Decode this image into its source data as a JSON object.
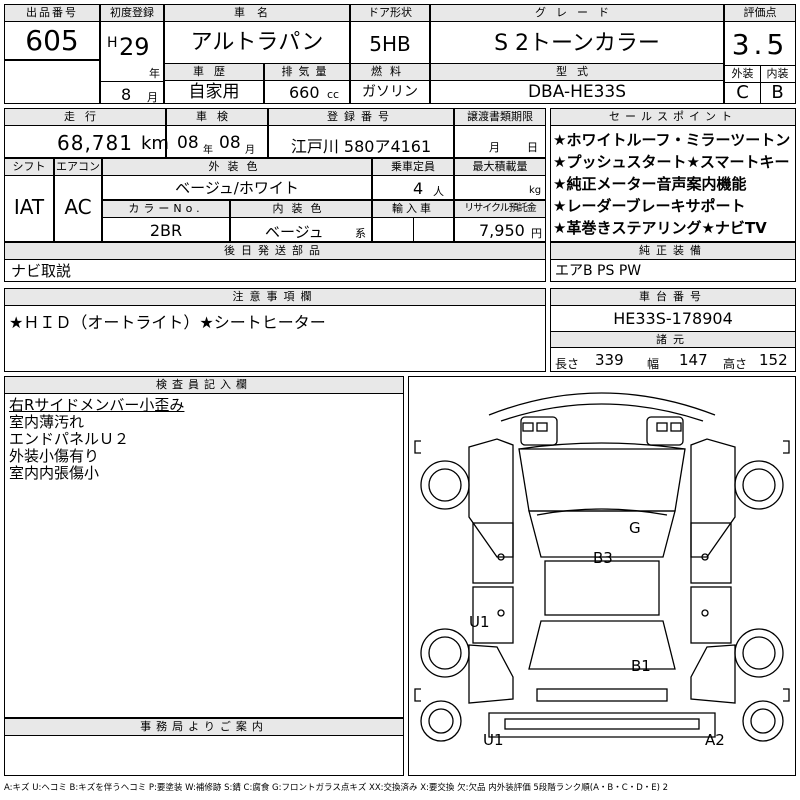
{
  "header_labels": {
    "lot_no": "出品番号",
    "first_reg": "初度登録",
    "car_name": "車名",
    "door": "ドア形状",
    "grade": "グレード",
    "rating": "評価点",
    "history": "車歴",
    "displacement": "排気量",
    "fuel": "燃料",
    "model": "型式",
    "exterior": "外装",
    "interior": "内装",
    "year_unit": "年",
    "month_unit": "月"
  },
  "lot_no": "605",
  "first_reg": {
    "era": "H",
    "year": "29",
    "month": "8"
  },
  "car_name": "アルトラパン",
  "door_type": "5HB",
  "grade": "S 2トーンカラー",
  "rating": "3.5",
  "history": "自家用",
  "displacement": "660",
  "displacement_unit": "cc",
  "fuel": "ガソリン",
  "model_code": "DBA-HE33S",
  "exterior_grade": "C",
  "interior_grade": "B",
  "row2_labels": {
    "mileage": "走行",
    "inspection": "車検",
    "reg_no": "登録番号",
    "transfer_docs": "譲渡書類期限",
    "selling_points": "セールスポイント",
    "shift": "シフト",
    "aircon": "エアコン",
    "ext_color": "外装色",
    "capacity": "乗車定員",
    "max_load": "最大積載量",
    "color_no": "カラーNo.",
    "int_color": "内装色",
    "import": "輸入車",
    "recycle": "リサイクル預託金",
    "later_parts": "後日発送部品",
    "genuine": "純正装備",
    "notes": "注意事項欄",
    "chassis": "車台番号",
    "dims": "諸元",
    "inspector": "検査員記入欄",
    "office": "事務局よりご案内"
  },
  "mileage": "68,781",
  "mileage_unit": "km",
  "inspection": {
    "year": "08",
    "month": "08",
    "year_unit": "年",
    "month_unit": "月"
  },
  "reg_no": "江戸川 580ア4161",
  "transfer_units": {
    "month": "月",
    "day": "日"
  },
  "selling_points": [
    "★ホワイトルーフ・ミラーツートン",
    "★プッシュスタート★スマートキー",
    "★純正メーター音声案内機能",
    "★レーダーブレーキサポート",
    "★革巻きステアリング★ナビTV"
  ],
  "shift": "IAT",
  "aircon": "AC",
  "ext_color": "ベージュ/ホワイト",
  "capacity": "4",
  "capacity_unit": "人",
  "max_load_unit": "kg",
  "color_no": "2BR",
  "int_color": "ベージュ",
  "int_color_unit": "系",
  "recycle": "7,950",
  "recycle_unit": "円",
  "later_parts": "ナビ取説",
  "genuine": "エアB PS PW",
  "notes": "★ＨＩＤ（オートライト）★シートヒーター",
  "chassis_no": "HE33S-178904",
  "dims": {
    "length_label": "長さ",
    "length": "339",
    "width_label": "幅",
    "width": "147",
    "height_label": "高さ",
    "height": "152"
  },
  "inspector_notes": [
    "右Rサイドメンバー小歪み",
    "室内薄汚れ",
    "エンドパネルＵ２",
    "外装小傷有り",
    "室内内張傷小"
  ],
  "diagram_marks": [
    "G",
    "B3",
    "U1",
    "B1",
    "U1",
    "A2"
  ],
  "legend": "A:キズ U:ヘコミ B:キズを伴うヘコミ P:要塗装 W:補修跡 S:錆 C:腐食 G:フロントガラス点キズ XX:交換済み X:要交換 欠:欠品 内外装評価 5段階ランク順(A・B・C・D・E) 2"
}
